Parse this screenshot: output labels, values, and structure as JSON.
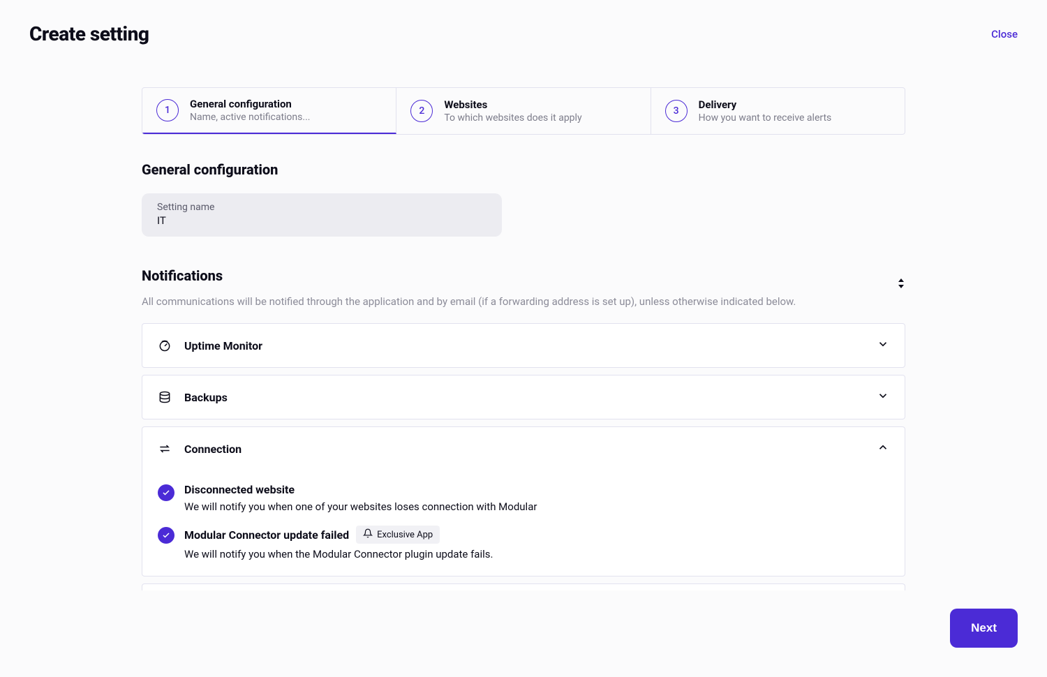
{
  "header": {
    "title": "Create setting",
    "close": "Close"
  },
  "stepper": [
    {
      "num": "1",
      "title": "General configuration",
      "subtitle": "Name, active notifications..."
    },
    {
      "num": "2",
      "title": "Websites",
      "subtitle": "To which websites does it apply"
    },
    {
      "num": "3",
      "title": "Delivery",
      "subtitle": "How you want to receive alerts"
    }
  ],
  "section_general_title": "General configuration",
  "setting_name_label": "Setting name",
  "setting_name_value": "IT",
  "section_notifications_title": "Notifications",
  "notifications_desc": "All communications will be notified through the application and by email (if a forwarding address is set up), unless otherwise indicated below.",
  "panels": {
    "uptime": {
      "title": "Uptime Monitor"
    },
    "backups": {
      "title": "Backups"
    },
    "connection": {
      "title": "Connection",
      "items": [
        {
          "title": "Disconnected website",
          "desc": "We will notify you when one of your websites loses connection with Modular",
          "badge": null
        },
        {
          "title": "Modular Connector update failed",
          "desc": "We will notify you when the Modular Connector plugin update fails.",
          "badge": "Exclusive App"
        }
      ]
    }
  },
  "next_button": "Next"
}
